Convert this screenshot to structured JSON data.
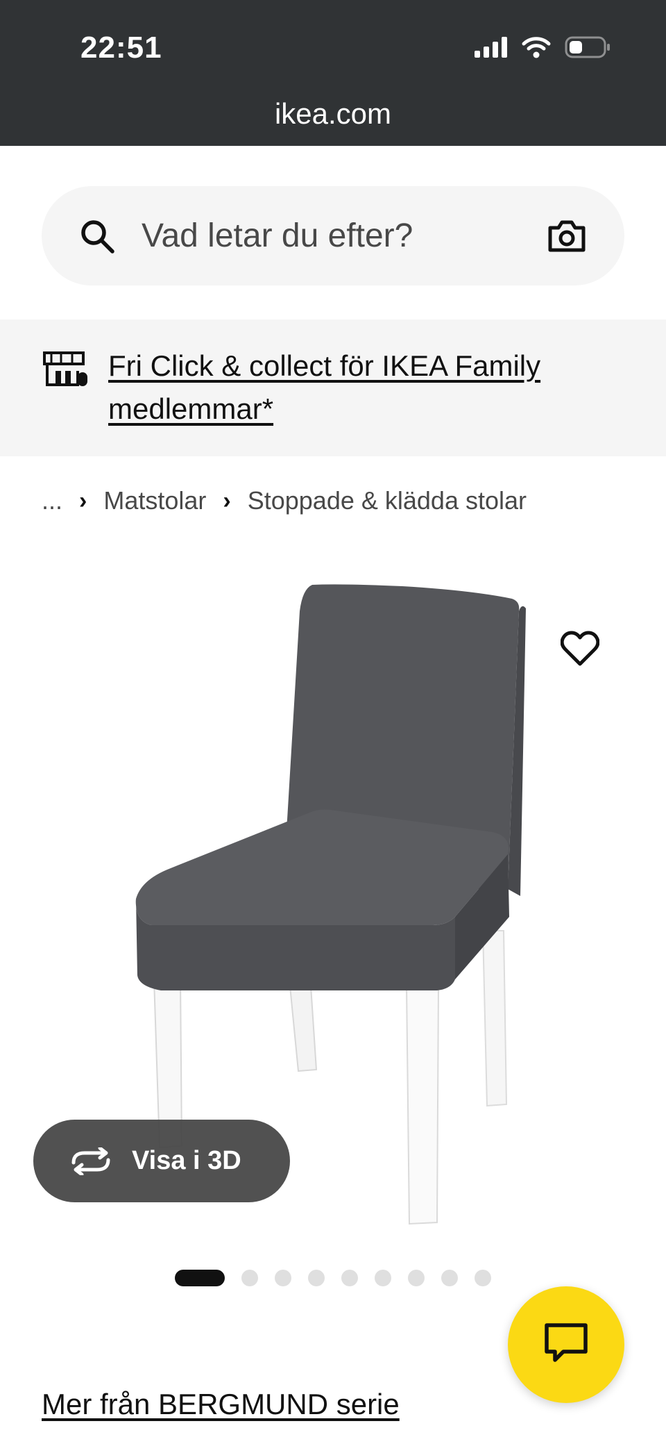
{
  "status_bar": {
    "time": "22:51"
  },
  "browser": {
    "url": "ikea.com"
  },
  "search": {
    "placeholder": "Vad letar du efter?"
  },
  "promo": {
    "text": "Fri Click & collect för IKEA Family medlemmar*"
  },
  "breadcrumb": {
    "items": [
      "...",
      "Matstolar",
      "Stoppade & klädda stolar"
    ]
  },
  "product": {
    "view_3d_label": "Visa i 3D",
    "image_count": 10,
    "active_image": 1
  },
  "series_link": "Mer från BERGMUND serie",
  "colors": {
    "brand_yellow": "#fbd914",
    "topbar": "#303335",
    "chair_fabric": "#55565a"
  },
  "icons": {
    "search": "search-icon",
    "camera": "camera-icon",
    "store": "store-icon",
    "favourite": "heart-icon",
    "rotate": "rotate-3d-icon",
    "chat": "chat-icon"
  }
}
